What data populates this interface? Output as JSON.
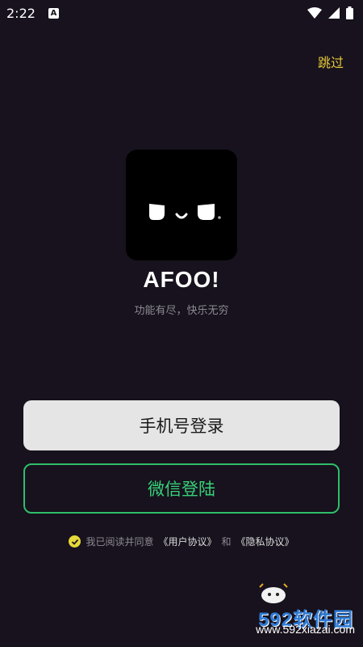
{
  "status": {
    "time": "2:22",
    "badge": "A"
  },
  "header": {
    "skip_label": "跳过"
  },
  "brand": {
    "name": "AFOO!",
    "slogan": "功能有尽，快乐无穷"
  },
  "buttons": {
    "phone_login": "手机号登录",
    "wechat_login": "微信登陆"
  },
  "agreement": {
    "prefix": "我已阅读并同意",
    "user_agreement": "《用户协议》",
    "and": "和",
    "privacy_agreement": "《隐私协议》"
  },
  "watermark": {
    "brand": "592软件园",
    "url": "www.592xiazai.com"
  },
  "colors": {
    "background": "#17121d",
    "accent_yellow": "#e6c93a",
    "wechat_green": "#36d27a"
  },
  "icons": [
    "wifi-icon",
    "signal-icon",
    "battery-icon",
    "check-icon"
  ]
}
